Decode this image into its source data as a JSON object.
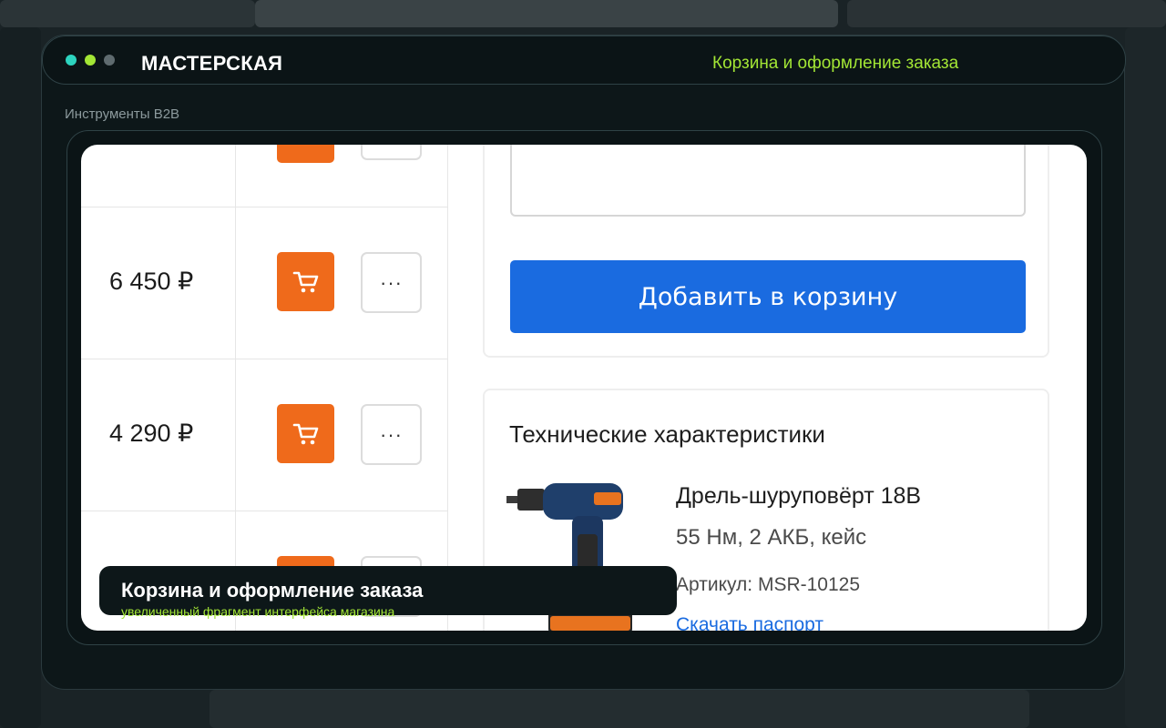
{
  "colors": {
    "window_dot_1": "#2dd4bf",
    "window_dot_2": "#a3e635",
    "window_dot_3": "#5f6b6f",
    "accent": "#a3e635",
    "cart_button": "#ef6a1b",
    "primary_button": "#1a6be0"
  },
  "header": {
    "brand": "МАСТЕРСКАЯ",
    "link": "Корзина и оформление заказа"
  },
  "section_label": "Инструменты B2B",
  "product_table": {
    "rows": [
      {
        "price": "",
        "cart_icon": "cart-icon",
        "more_label": ""
      },
      {
        "price": "6 450 ₽",
        "cart_icon": "cart-icon",
        "more_label": "···"
      },
      {
        "price": "4 290 ₽",
        "cart_icon": "cart-icon",
        "more_label": "···"
      },
      {
        "price": "",
        "cart_icon": "cart-icon",
        "more_label": ""
      }
    ]
  },
  "order_panel": {
    "comment_value": "",
    "add_to_cart_label": "Добавить в корзину"
  },
  "specs": {
    "heading": "Технические характеристики",
    "product_name": "Дрель-шуруповёрт 18В",
    "product_specs": "55 Нм, 2 АКБ, кейс",
    "sku": "Артикул: MSR-10125",
    "download_link": "Скачать паспорт"
  },
  "caption": {
    "title": "Корзина и оформление заказа",
    "subtitle": "увеличенный фрагмент интерфейса магазина"
  }
}
